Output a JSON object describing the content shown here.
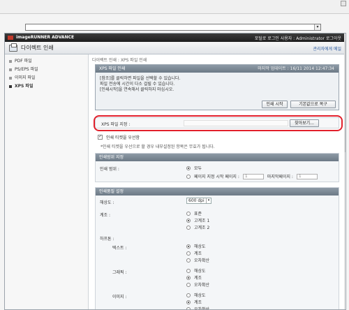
{
  "topbar": {
    "brand": "imageRUNNER ADVANCE",
    "user": "포털로  로그인 사용자 : Administrator 로그아웃"
  },
  "titlebar": {
    "title": "다이렉트 인쇄",
    "manager_link": "관리자에게 메일"
  },
  "sidebar": {
    "items": [
      "PDF 파일",
      "PS/EPS 파일",
      "이미지 파일",
      "XPS 파일"
    ]
  },
  "breadcrumb": "다이렉트 인쇄 : XPS 파일 인쇄",
  "panel": {
    "title": "XPS 파일 인쇄",
    "updated": "마지막 업데이트 : 16/11 2014 12:47:34",
    "lines": [
      "[참조]를 클릭하면 파일을 선택할 수 있습니다.",
      "파일 전송에 시간이 다소 걸릴 수 있습니다.",
      "[인쇄시작]을 연속해서 클릭하지 마십시오."
    ],
    "buttons": {
      "start": "인쇄 시작",
      "reset": "기본값으로 복구"
    }
  },
  "file": {
    "label": "XPS 파일 지정 :",
    "browse": "찾아보기..."
  },
  "ticket": {
    "label": "인쇄 티켓을 우선함",
    "checked": true,
    "note": "*인쇄 티켓을 우선으로 할 경우 내부설정된 항목은 무효가 됩니다."
  },
  "range": {
    "heading": "인쇄범위 지정",
    "label": "인쇄 범위 :",
    "all": "모두",
    "pages": "페이지 지정  시작 페이지 :",
    "start_value": "1",
    "end_label": "마지막페이지 :",
    "end_value": "1"
  },
  "quality": {
    "heading": "인쇄품질 설정",
    "resolution_label": "해상도 :",
    "resolution_value": "600 dpi",
    "gradation_label": "계조 :",
    "gradation_options": [
      "표준",
      "고계조 1",
      "고계조 2"
    ],
    "halftone_label": "하프톤 :",
    "text_label": "텍스트 :",
    "graphics_label": "그래픽 :",
    "image_label": "이미지 :",
    "halftone_options": [
      "해상도",
      "계조",
      "오차확산"
    ]
  }
}
